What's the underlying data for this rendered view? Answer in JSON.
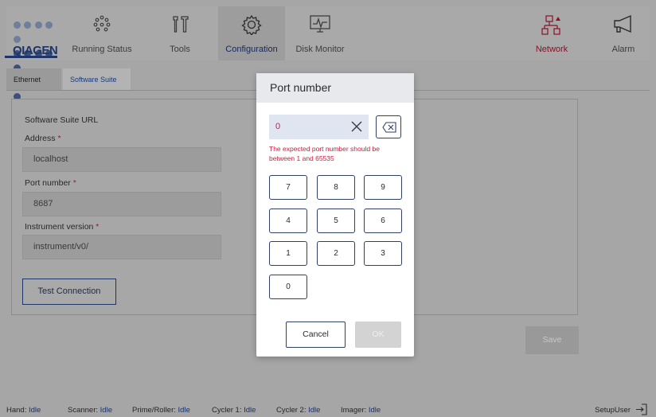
{
  "brand": {
    "name": "QIAGEN",
    "color": "#1e3569",
    "accent": "#9b1c2b"
  },
  "nav": {
    "items": [
      {
        "label": "Running Status",
        "icon": "dots-circle-icon"
      },
      {
        "label": "Tools",
        "icon": "tools-icon"
      },
      {
        "label": "Configuration",
        "icon": "gear-icon"
      },
      {
        "label": "Disk Monitor",
        "icon": "monitor-icon"
      },
      {
        "label": "Network",
        "icon": "network-icon"
      },
      {
        "label": "Alarm",
        "icon": "megaphone-icon"
      }
    ],
    "active": "Configuration"
  },
  "tabs": [
    {
      "label": "Ethernet"
    },
    {
      "label": "Software Suite"
    }
  ],
  "form": {
    "section_title": "Software Suite URL",
    "address_label": "Address",
    "address_value": "localhost",
    "port_label": "Port number",
    "port_value": "8687",
    "version_label": "Instrument version",
    "version_value": "instrument/v0/",
    "required_mark": "*",
    "test_button": "Test Connection",
    "save_button": "Save"
  },
  "modal": {
    "title": "Port number",
    "input_value": "0",
    "error": "The expected port number should be between 1 and 65535",
    "keys": [
      "7",
      "8",
      "9",
      "4",
      "5",
      "6",
      "1",
      "2",
      "3",
      "0"
    ],
    "cancel": "Cancel",
    "ok": "OK"
  },
  "status": {
    "items": [
      {
        "name": "Hand:",
        "value": "Idle"
      },
      {
        "name": "Scanner:",
        "value": "Idle"
      },
      {
        "name": "Prime/Roller:",
        "value": "Idle"
      },
      {
        "name": "Cycler 1:",
        "value": "Idle"
      },
      {
        "name": "Cycler 2:",
        "value": "Idle"
      },
      {
        "name": "Imager:",
        "value": "Idle"
      }
    ],
    "user": "SetupUser"
  }
}
